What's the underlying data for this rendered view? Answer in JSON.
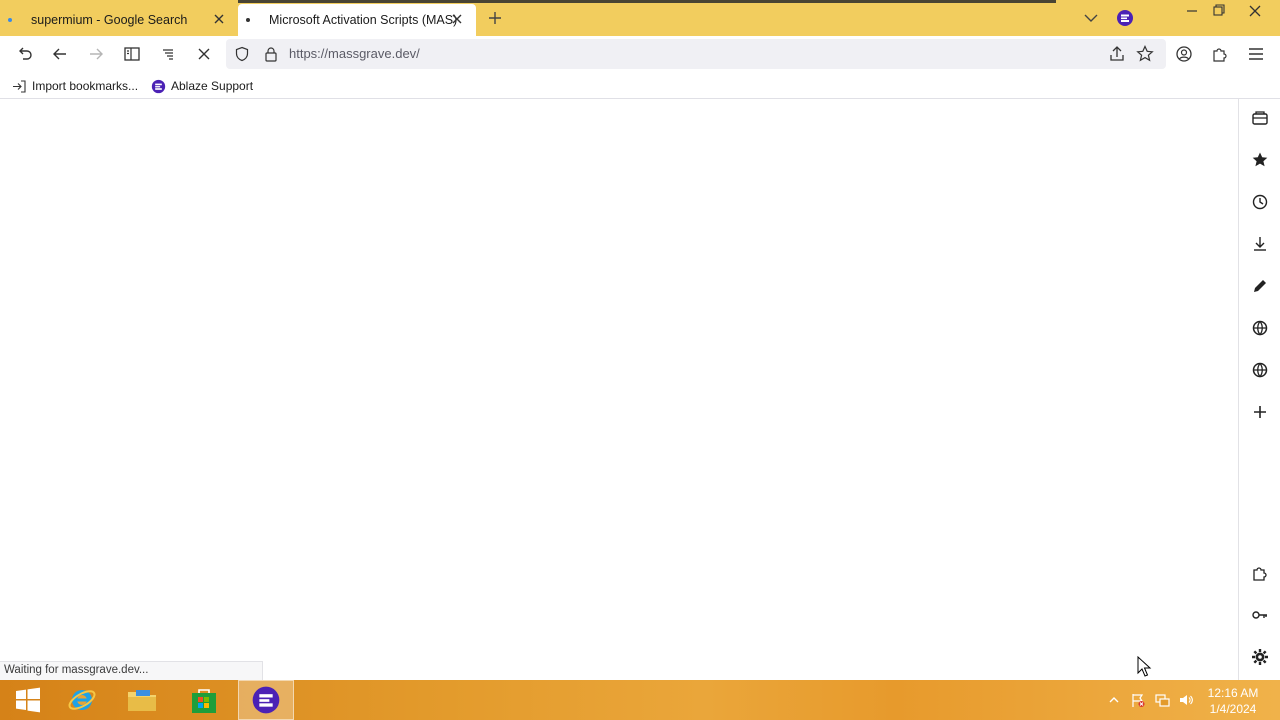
{
  "browser": {
    "tabs": [
      {
        "title": "supermium - Google Search",
        "active": false
      },
      {
        "title": "Microsoft Activation Scripts (MAS)",
        "active": true
      }
    ],
    "address": {
      "url": "https://massgrave.dev/"
    },
    "status_text": "Waiting for massgrave.dev...",
    "bookmarks": [
      {
        "label": "Import bookmarks...",
        "icon": "import-icon"
      },
      {
        "label": "Ablaze Support",
        "icon": "ablaze-logo"
      }
    ],
    "accent_color": "#f2cd5e"
  },
  "sidebar": {
    "items": [
      "wallet-icon",
      "bookmarks-star-icon",
      "history-clock-icon",
      "downloads-icon",
      "notes-pencil-icon",
      "web-panel-globe-icon",
      "web-panel-globe-icon-2",
      "add-panel-plus-icon",
      "extensions-icon",
      "passwords-key-icon",
      "settings-gear-icon"
    ]
  },
  "taskbar": {
    "apps": [
      "windows-start",
      "internet-explorer",
      "file-explorer",
      "store",
      "supermium-browser"
    ],
    "clock": {
      "time": "12:16 AM",
      "date": "1/4/2024"
    }
  }
}
